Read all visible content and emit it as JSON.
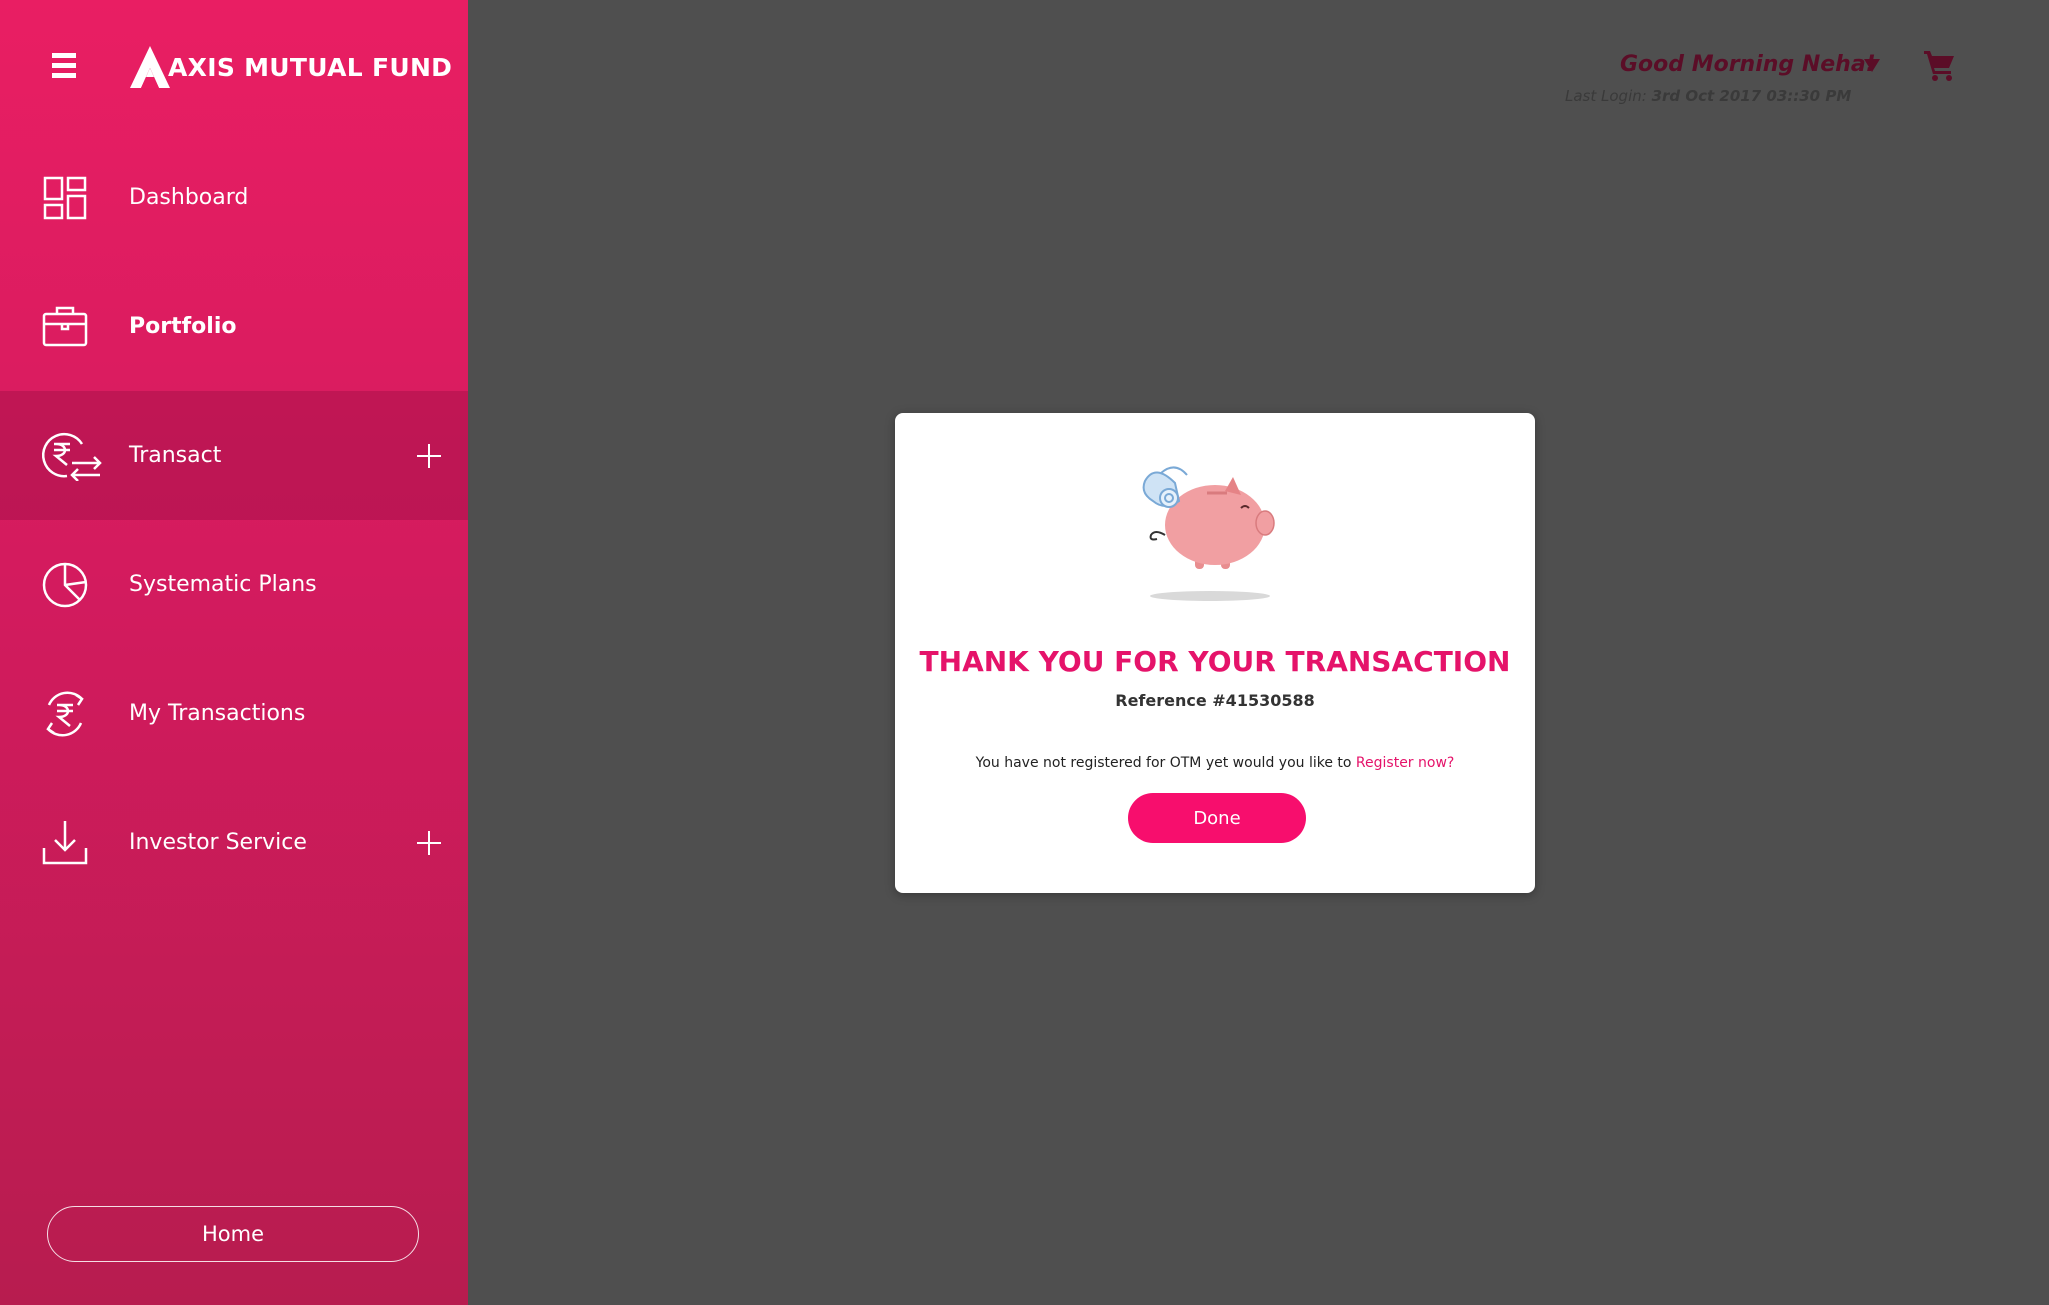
{
  "sidebar": {
    "logo_text": "AXIS MUTUAL FUND",
    "items": [
      {
        "label": "Dashboard",
        "icon": "dashboard-icon"
      },
      {
        "label": "Portfolio",
        "icon": "briefcase-icon"
      },
      {
        "label": "Transact",
        "icon": "rupee-exchange-icon",
        "expandable": true,
        "active": true
      },
      {
        "label": "Systematic Plans",
        "icon": "pie-chart-icon"
      },
      {
        "label": "My Transactions",
        "icon": "rupee-refresh-icon"
      },
      {
        "label": "Investor Service",
        "icon": "download-icon",
        "expandable": true
      }
    ],
    "home_label": "Home"
  },
  "header": {
    "greeting": "Good Morning Neha!",
    "last_login_label": "Last Login:",
    "last_login_value": "3rd Oct 2017 03::30 PM"
  },
  "modal": {
    "title": "THANK YOU FOR YOUR TRANSACTION",
    "reference": "Reference #41530588",
    "otm_message": "You have not registered for OTM yet would you like to",
    "register_link": "Register now?",
    "done_label": "Done"
  },
  "colors": {
    "sidebar_top": "#e91e63",
    "sidebar_bottom": "#b71c4f",
    "accent": "#e5136a",
    "button": "#f70e6d",
    "backdrop": "#4f4f4f"
  }
}
